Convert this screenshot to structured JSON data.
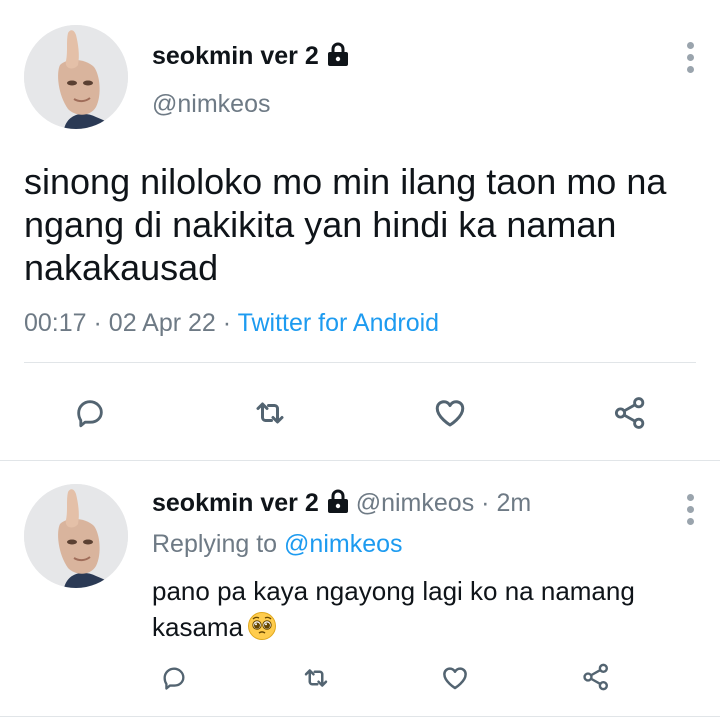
{
  "colors": {
    "text": "#0f1419",
    "secondary": "#6e7a85",
    "link": "#1d9bf0",
    "icon": "#536471",
    "divider": "#e1e5e8"
  },
  "main_tweet": {
    "author_name": "seokmin ver 2",
    "handle": "@nimkeos",
    "protected_icon": "lock-icon",
    "text": "sinong niloloko mo min ilang taon mo na ngang di nakikita yan hindi ka naman nakakausad",
    "time": "00:17",
    "separator": "·",
    "date": "02 Apr 22",
    "source": "Twitter for Android",
    "actions": [
      "reply-icon",
      "retweet-icon",
      "like-icon",
      "share-icon"
    ]
  },
  "reply_tweet": {
    "author_name": "seokmin ver 2",
    "handle": "@nimkeos",
    "separator": "·",
    "age": "2m",
    "replying_prefix": "Replying to",
    "replying_to": "@nimkeos",
    "text": "pano pa kaya ngayong lagi ko na namang kasama",
    "emoji": "pleading-face-emoji",
    "actions": [
      "reply-icon",
      "retweet-icon",
      "like-icon",
      "share-icon"
    ]
  }
}
